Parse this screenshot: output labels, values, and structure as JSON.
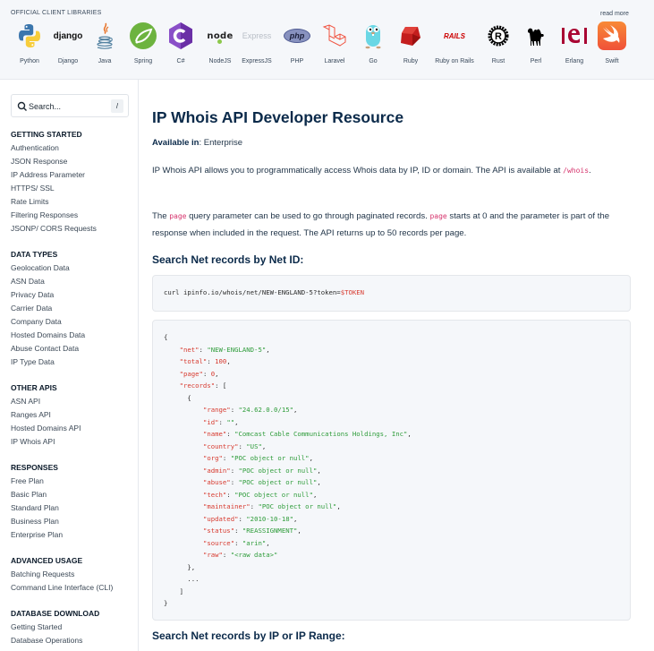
{
  "libraries": {
    "title": "OFFICIAL CLIENT LIBRARIES",
    "read_more": "read more",
    "items": [
      {
        "name": "Python",
        "icon": "python-logo-icon"
      },
      {
        "name": "Django",
        "icon": "django-logo-icon"
      },
      {
        "name": "Java",
        "icon": "java-logo-icon"
      },
      {
        "name": "Spring",
        "icon": "spring-logo-icon"
      },
      {
        "name": "C#",
        "icon": "csharp-logo-icon"
      },
      {
        "name": "NodeJS",
        "icon": "nodejs-logo-icon"
      },
      {
        "name": "ExpressJS",
        "icon": "expressjs-logo-icon"
      },
      {
        "name": "PHP",
        "icon": "php-logo-icon"
      },
      {
        "name": "Laravel",
        "icon": "laravel-logo-icon"
      },
      {
        "name": "Go",
        "icon": "go-gopher-icon"
      },
      {
        "name": "Ruby",
        "icon": "ruby-logo-icon"
      },
      {
        "name": "Ruby on Rails",
        "icon": "rails-logo-icon"
      },
      {
        "name": "Rust",
        "icon": "rust-logo-icon"
      },
      {
        "name": "Perl",
        "icon": "perl-camel-icon"
      },
      {
        "name": "Erlang",
        "icon": "erlang-logo-icon"
      },
      {
        "name": "Swift",
        "icon": "swift-logo-icon"
      }
    ],
    "logo_text": {
      "django": "django",
      "express": "Express",
      "php": "php",
      "rails": "RAILS",
      "node": "node"
    }
  },
  "sidebar": {
    "search": {
      "placeholder": "Search...",
      "shortcut": "/"
    },
    "sections": [
      {
        "heading": "GETTING STARTED",
        "items": [
          "Authentication",
          "JSON Response",
          "IP Address Parameter",
          "HTTPS/ SSL",
          "Rate Limits",
          "Filtering Responses",
          "JSONP/ CORS Requests"
        ]
      },
      {
        "heading": "DATA TYPES",
        "items": [
          "Geolocation Data",
          "ASN Data",
          "Privacy Data",
          "Carrier Data",
          "Company Data",
          "Hosted Domains Data",
          "Abuse Contact Data",
          "IP Type Data"
        ]
      },
      {
        "heading": "OTHER APIS",
        "items": [
          "ASN API",
          "Ranges API",
          "Hosted Domains API",
          "IP Whois API"
        ]
      },
      {
        "heading": "RESPONSES",
        "items": [
          "Free Plan",
          "Basic Plan",
          "Standard Plan",
          "Business Plan",
          "Enterprise Plan"
        ]
      },
      {
        "heading": "ADVANCED USAGE",
        "items": [
          "Batching Requests",
          "Command Line Interface (CLI)"
        ]
      },
      {
        "heading": "DATABASE DOWNLOAD",
        "items": [
          "Getting Started",
          "Database Operations"
        ]
      }
    ]
  },
  "main": {
    "title": "IP Whois API Developer Resource",
    "available_label": "Available in",
    "available_value": ": Enterprise",
    "intro": {
      "text": "IP Whois API allows you to programmatically access Whois data by IP, ID or domain. The API is available at ",
      "code": "/whois",
      "after": "."
    },
    "page_para": {
      "t1": "The ",
      "code1": "page",
      "t2": " query parameter can be used to go through paginated records. ",
      "code2": "page",
      "t3": " starts at 0 and the parameter is part of the response when included in the request. The API returns up to 50 records per page."
    },
    "section1_heading": "Search Net records by Net ID:",
    "curl": {
      "command": "curl ipinfo.io/whois/net/NEW-ENGLAND-5?token=",
      "token_var": "$TOKEN"
    },
    "response_lines": [
      {
        "indent": 0,
        "parts": [
          [
            "p",
            "{"
          ]
        ]
      },
      {
        "indent": 1,
        "parts": [
          [
            "k",
            "\"net\""
          ],
          [
            "p",
            ": "
          ],
          [
            "s",
            "\"NEW-ENGLAND-5\""
          ],
          [
            "p",
            ","
          ]
        ]
      },
      {
        "indent": 1,
        "parts": [
          [
            "k",
            "\"total\""
          ],
          [
            "p",
            ": "
          ],
          [
            "n",
            "100"
          ],
          [
            "p",
            ","
          ]
        ]
      },
      {
        "indent": 1,
        "parts": [
          [
            "k",
            "\"page\""
          ],
          [
            "p",
            ": "
          ],
          [
            "n",
            "0"
          ],
          [
            "p",
            ","
          ]
        ]
      },
      {
        "indent": 1,
        "parts": [
          [
            "k",
            "\"records\""
          ],
          [
            "p",
            ": ["
          ]
        ]
      },
      {
        "indent": 2,
        "parts": [
          [
            "p",
            "{"
          ]
        ]
      },
      {
        "indent": 3,
        "parts": [
          [
            "k",
            "\"range\""
          ],
          [
            "p",
            ": "
          ],
          [
            "s",
            "\"24.62.0.0/15\""
          ],
          [
            "p",
            ","
          ]
        ]
      },
      {
        "indent": 3,
        "parts": [
          [
            "k",
            "\"id\""
          ],
          [
            "p",
            ": "
          ],
          [
            "s",
            "\"\""
          ],
          [
            "p",
            ","
          ]
        ]
      },
      {
        "indent": 3,
        "parts": [
          [
            "k",
            "\"name\""
          ],
          [
            "p",
            ": "
          ],
          [
            "s",
            "\"Comcast Cable Communications Holdings, Inc\""
          ],
          [
            "p",
            ","
          ]
        ]
      },
      {
        "indent": 3,
        "parts": [
          [
            "k",
            "\"country\""
          ],
          [
            "p",
            ": "
          ],
          [
            "s",
            "\"US\""
          ],
          [
            "p",
            ","
          ]
        ]
      },
      {
        "indent": 3,
        "parts": [
          [
            "k",
            "\"org\""
          ],
          [
            "p",
            ": "
          ],
          [
            "s",
            "\"POC object or null\""
          ],
          [
            "p",
            ","
          ]
        ]
      },
      {
        "indent": 3,
        "parts": [
          [
            "k",
            "\"admin\""
          ],
          [
            "p",
            ": "
          ],
          [
            "s",
            "\"POC object or null\""
          ],
          [
            "p",
            ","
          ]
        ]
      },
      {
        "indent": 3,
        "parts": [
          [
            "k",
            "\"abuse\""
          ],
          [
            "p",
            ": "
          ],
          [
            "s",
            "\"POC object or null\""
          ],
          [
            "p",
            ","
          ]
        ]
      },
      {
        "indent": 3,
        "parts": [
          [
            "k",
            "\"tech\""
          ],
          [
            "p",
            ": "
          ],
          [
            "s",
            "\"POC object or null\""
          ],
          [
            "p",
            ","
          ]
        ]
      },
      {
        "indent": 3,
        "parts": [
          [
            "k",
            "\"maintainer\""
          ],
          [
            "p",
            ": "
          ],
          [
            "s",
            "\"POC object or null\""
          ],
          [
            "p",
            ","
          ]
        ]
      },
      {
        "indent": 3,
        "parts": [
          [
            "k",
            "\"updated\""
          ],
          [
            "p",
            ": "
          ],
          [
            "s",
            "\"2010-10-18\""
          ],
          [
            "p",
            ","
          ]
        ]
      },
      {
        "indent": 3,
        "parts": [
          [
            "k",
            "\"status\""
          ],
          [
            "p",
            ": "
          ],
          [
            "s",
            "\"REASSIGNMENT\""
          ],
          [
            "p",
            ","
          ]
        ]
      },
      {
        "indent": 3,
        "parts": [
          [
            "k",
            "\"source\""
          ],
          [
            "p",
            ": "
          ],
          [
            "s",
            "\"arin\""
          ],
          [
            "p",
            ","
          ]
        ]
      },
      {
        "indent": 3,
        "parts": [
          [
            "k",
            "\"raw\""
          ],
          [
            "p",
            ": "
          ],
          [
            "s",
            "\"<raw data>\""
          ]
        ]
      },
      {
        "indent": 2,
        "parts": [
          [
            "p",
            "},"
          ]
        ]
      },
      {
        "indent": 2,
        "parts": [
          [
            "p",
            "..."
          ]
        ]
      },
      {
        "indent": 1,
        "parts": [
          [
            "p",
            "]"
          ]
        ]
      },
      {
        "indent": 0,
        "parts": [
          [
            "p",
            "}"
          ]
        ]
      }
    ],
    "section2_heading": "Search Net records by IP or IP Range:"
  },
  "colors": {
    "heading": "#0b2a4a",
    "code_key": "#d73a2f",
    "code_string": "#2e9c3a",
    "inline_code": "#d6336c",
    "panel_bg": "#f5f7fa"
  }
}
